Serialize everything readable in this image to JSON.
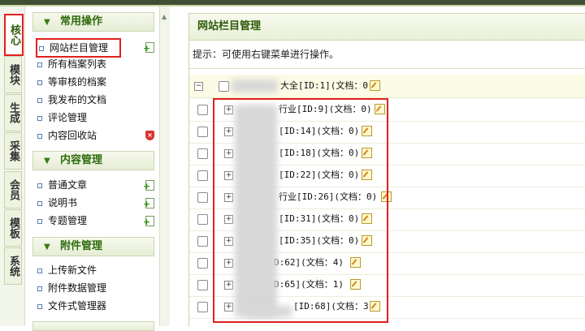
{
  "tabs": [
    "核心",
    "模块",
    "生成",
    "采集",
    "会员",
    "模板",
    "系统"
  ],
  "menu": {
    "groups": [
      {
        "title": "常用操作",
        "items": [
          "网站栏目管理",
          "所有档案列表",
          "等审核的档案",
          "我发布的文档",
          "评论管理",
          "内容回收站"
        ]
      },
      {
        "title": "内容管理",
        "items": [
          "普通文章",
          "说明书",
          "专题管理"
        ]
      },
      {
        "title": "附件管理",
        "items": [
          "上传新文件",
          "附件数据管理",
          "文件式管理器"
        ]
      }
    ]
  },
  "panel": {
    "title": "网站栏目管理",
    "tip": "提示：可使用右键菜单进行操作。",
    "root": "大全[ID:1](文档：0)",
    "rows": [
      "行业[ID:9](文档：0)",
      "[ID:14](文档：0)",
      "[ID:18](文档：0)",
      "[ID:22](文档：0)",
      "行业[ID:26](文档：0)",
      "[ID:31](文档：0)",
      "[ID:35](文档：0)",
      "D:62](文档：4)",
      "D:65](文档：1)",
      "[ID:68](文档：3)"
    ]
  },
  "colors": {
    "accent": "#2c5a08",
    "highlight": "#e02020",
    "topbar": "#3f4f33"
  },
  "icons": [
    "collapse-icon",
    "expand-icon",
    "edit-icon",
    "add-icon",
    "recycle-shield-icon",
    "chevron-down-icon"
  ]
}
